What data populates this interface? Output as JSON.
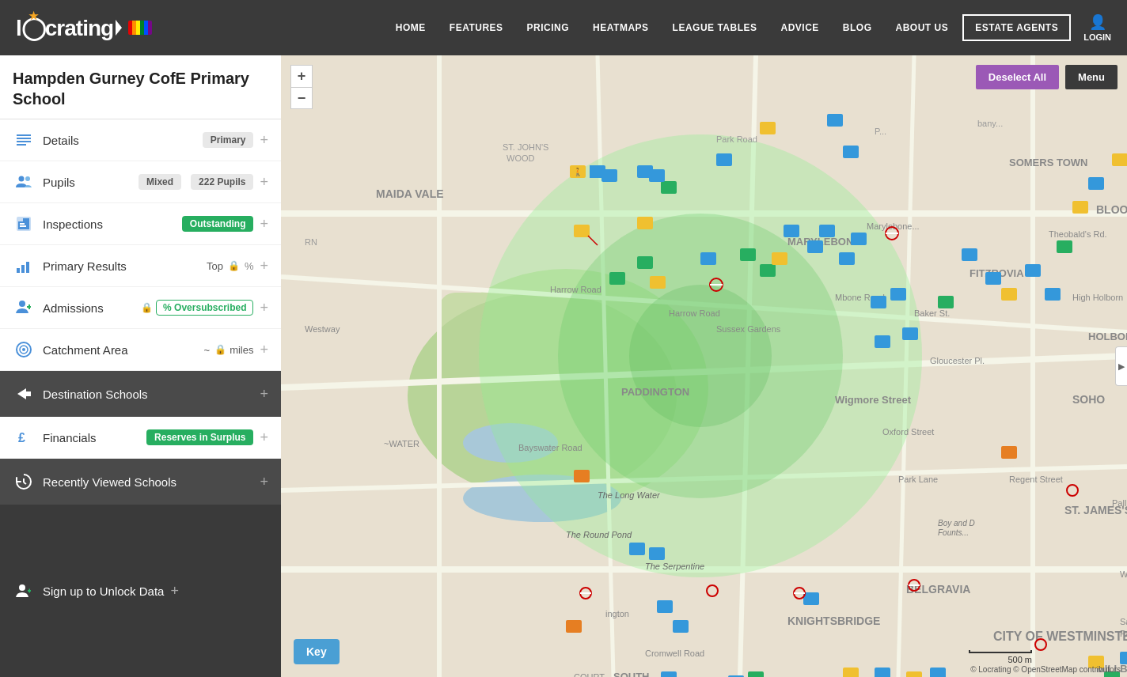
{
  "header": {
    "logo": "locrating",
    "logo_star": "★",
    "nav_items": [
      "HOME",
      "FEATURES",
      "PRICING",
      "HEATMAPS",
      "LEAGUE TABLES",
      "ADVICE",
      "BLOG",
      "ABOUT US"
    ],
    "estate_agents_label": "ESTATE AGENTS",
    "login_label": "LOGIN"
  },
  "sidebar": {
    "school_name": "Hampden Gurney CofE Primary School",
    "items": [
      {
        "id": "details",
        "label": "Details",
        "badge": "Primary",
        "badge_type": "gray"
      },
      {
        "id": "pupils",
        "label": "Pupils",
        "badge1": "Mixed",
        "badge1_type": "gray",
        "badge2": "222 Pupils",
        "badge2_type": "gray"
      },
      {
        "id": "inspections",
        "label": "Inspections",
        "badge": "Outstanding",
        "badge_type": "outstanding"
      },
      {
        "id": "primary-results",
        "label": "Primary Results",
        "top": "Top",
        "has_lock": true,
        "has_percent": true
      },
      {
        "id": "admissions",
        "label": "Admissions",
        "has_lock": true,
        "badge": "% Oversubscribed",
        "badge_type": "green-outline"
      },
      {
        "id": "catchment",
        "label": "Catchment Area",
        "tilde": "~",
        "has_lock": true,
        "suffix": "miles"
      },
      {
        "id": "destination",
        "label": "Destination Schools",
        "dark": true
      },
      {
        "id": "financials",
        "label": "Financials",
        "badge": "Reserves in Surplus",
        "badge_type": "surplus"
      },
      {
        "id": "recently-viewed",
        "label": "Recently Viewed Schools",
        "dark": true
      },
      {
        "id": "signup",
        "label": "Sign up to Unlock Data",
        "darkest": true
      }
    ]
  },
  "map": {
    "deselect_label": "Deselect All",
    "menu_label": "Menu",
    "zoom_in": "+",
    "zoom_out": "−",
    "key_label": "Key",
    "scale_label": "500 m",
    "attribution": "© Locrating © OpenStreetMap contributors"
  },
  "icons": {
    "details": "☰",
    "pupils": "👥",
    "inspections": "🎨",
    "results": "📊",
    "admissions": "👤",
    "catchment": "⭕",
    "destination": "➤",
    "financials": "£",
    "recently": "🔄",
    "signup": "👤",
    "lock": "🔒"
  }
}
